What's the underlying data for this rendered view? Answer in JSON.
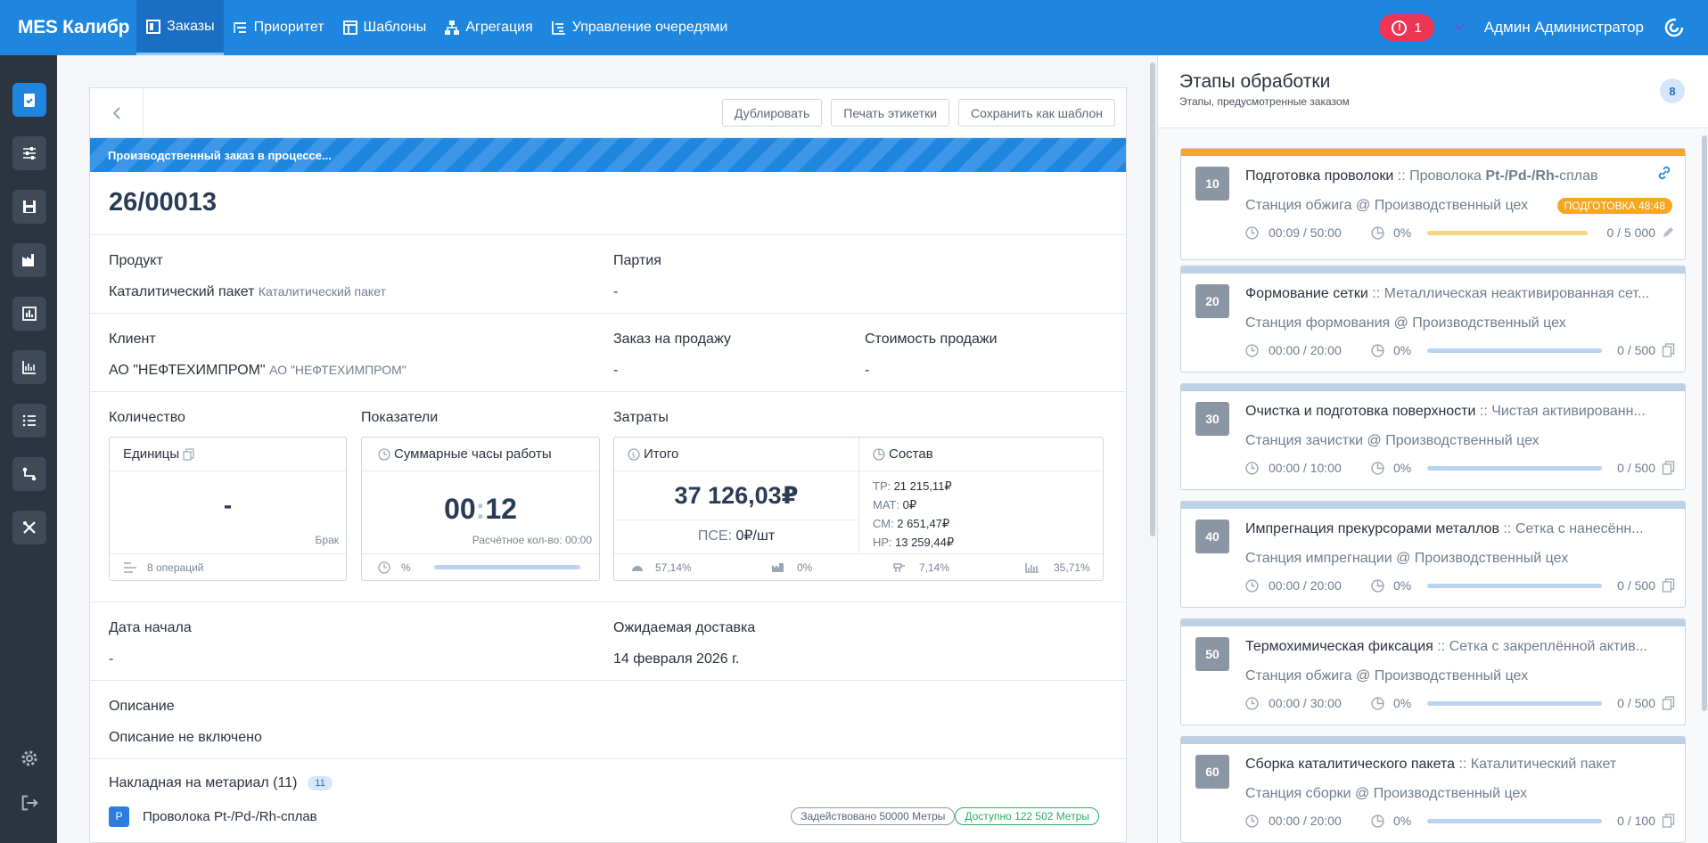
{
  "nav": {
    "brand": "MES Калибр",
    "items": [
      {
        "label": "Заказы",
        "icon": "orders-icon"
      },
      {
        "label": "Приоритет",
        "icon": "priority-icon"
      },
      {
        "label": "Шаблоны",
        "icon": "templates-icon"
      },
      {
        "label": "Агрегация",
        "icon": "aggregation-icon"
      },
      {
        "label": "Управление очередями",
        "icon": "queue-icon"
      }
    ],
    "alert_count": "1",
    "user": "Админ Администратор"
  },
  "toolbar": {
    "duplicate": "Дублировать",
    "print_labels": "Печать этикетки",
    "save_template": "Сохранить как шаблон"
  },
  "order": {
    "status_banner": "Производственный заказ в процессе...",
    "number": "26/00013",
    "product_label": "Продукт",
    "product_value": "Каталитический пакет",
    "product_sub": "Каталитический пакет",
    "batch_label": "Партия",
    "batch_value": "-",
    "client_label": "Клиент",
    "client_value": "АО \"НЕФТЕХИМПРОМ\"",
    "client_sub": "АО \"НЕФТЕХИМПРОМ\"",
    "sales_order_label": "Заказ на продажу",
    "sales_order_value": "-",
    "sales_cost_label": "Стоимость продажи",
    "sales_cost_value": "-",
    "quantity_label": "Количество",
    "indicators_label": "Показатели",
    "costs_label": "Затраты",
    "units_card": {
      "title": "Единицы",
      "value": "-",
      "scrap": "Брак",
      "ops": "8 операций"
    },
    "hours_card": {
      "title": "Суммарные часы работы",
      "hh": "00",
      "colon": ":",
      "mm": "12",
      "calc": "Расчётное кол-во: 00:00",
      "pct": "%"
    },
    "total_card": {
      "title": "Итого",
      "amount": "37 126,03₽",
      "pse_label": "ПСЕ: ",
      "pse_value": "0₽/шт"
    },
    "composition_card": {
      "title": "Состав",
      "lines": [
        {
          "k": "ТР: ",
          "v": "21 215,11₽"
        },
        {
          "k": "МАТ: ",
          "v": "0₽"
        },
        {
          "k": "СМ: ",
          "v": "2 651,47₽"
        },
        {
          "k": "НР: ",
          "v": "13 259,44₽"
        }
      ]
    },
    "cost_footer": [
      "57,14%",
      "0%",
      "7,14%",
      "35,71%"
    ],
    "start_date_label": "Дата начала",
    "start_date_value": "-",
    "delivery_label": "Ожидаемая доставка",
    "delivery_value": "14 февраля 2026 г.",
    "description_label": "Описание",
    "description_value": "Описание не включено",
    "bom_label": "Накладная на метариал (11)",
    "bom_count": "11",
    "material": {
      "badge": "P",
      "name": "Проволока Pt-/Pd-/Rh-сплав",
      "used": "Задействовано 50000 Метры",
      "available": "Доступно 122 502 Метры"
    }
  },
  "stages_panel": {
    "title": "Этапы обработки",
    "subtitle": "Этапы, предусмотренные заказом",
    "count": "8",
    "stages": [
      {
        "num": "10",
        "name": "Подготовка проволоки",
        "sep": " :: ",
        "product_pre": "Проволока ",
        "product_bold": "Pt-/Pd-/Rh-",
        "product_post": "сплав",
        "station": "Станция обжига @ Производственный цех",
        "badge": "ПОДГОТОВКА  48:48",
        "time": "00:09 / 50:00",
        "pct": "0%",
        "qty": "0 / 5 000",
        "bar_color": "#f8d57e"
      },
      {
        "num": "20",
        "name": "Формование сетки",
        "sep": " :: ",
        "product_pre": "Металлическая неактивированная сет...",
        "product_bold": "",
        "product_post": "",
        "station": "Станция формования @ Производственный цех",
        "badge": "",
        "time": "00:00 / 20:00",
        "pct": "0%",
        "qty": "0 / 500",
        "bar_color": "#b9d3f2"
      },
      {
        "num": "30",
        "name": "Очистка и подготовка поверхности",
        "sep": " :: ",
        "product_pre": "Чистая активированн...",
        "product_bold": "",
        "product_post": "",
        "station": "Станция зачистки @ Производственный цех",
        "badge": "",
        "time": "00:00 / 10:00",
        "pct": "0%",
        "qty": "0 / 500",
        "bar_color": "#b9d3f2"
      },
      {
        "num": "40",
        "name": "Импрегнация прекурсорами металлов",
        "sep": " :: ",
        "product_pre": "Сетка с нанесённ...",
        "product_bold": "",
        "product_post": "",
        "station": "Станция импрегнации @ Производственный цех",
        "badge": "",
        "time": "00:00 / 20:00",
        "pct": "0%",
        "qty": "0 / 500",
        "bar_color": "#b9d3f2"
      },
      {
        "num": "50",
        "name": "Термохимическая фиксация",
        "sep": " :: ",
        "product_pre": "Сетка с закреплённой актив...",
        "product_bold": "",
        "product_post": "",
        "station": "Станция обжига @ Производственный цех",
        "badge": "",
        "time": "00:00 / 30:00",
        "pct": "0%",
        "qty": "0 / 500",
        "bar_color": "#b9d3f2"
      },
      {
        "num": "60",
        "name": "Сборка каталитического пакета",
        "sep": " :: ",
        "product_pre": "Каталитический пакет",
        "product_bold": "",
        "product_post": "",
        "station": "Станция сборки @ Производственный цех",
        "badge": "",
        "time": "00:00 / 20:00",
        "pct": "0%",
        "qty": "0 / 100",
        "bar_color": "#b9d3f2"
      }
    ]
  }
}
